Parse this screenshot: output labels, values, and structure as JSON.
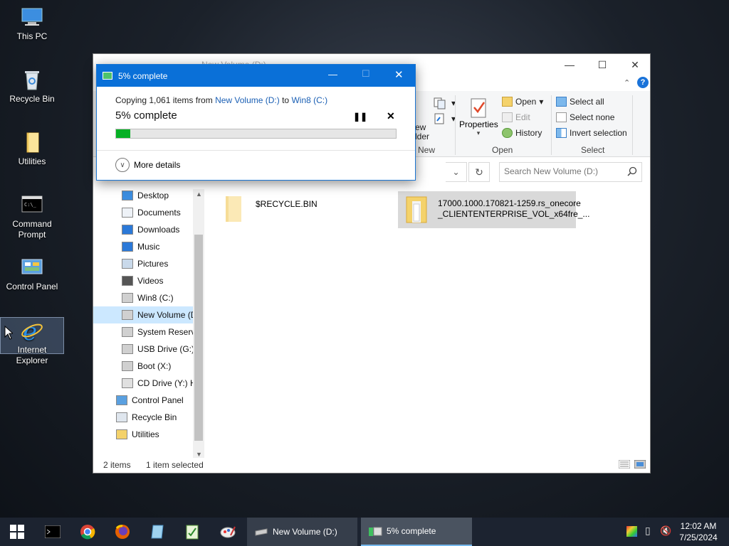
{
  "desktop": {
    "icons": [
      {
        "label": "This PC",
        "icon": "computer-icon"
      },
      {
        "label": "Recycle Bin",
        "icon": "recycle-bin-icon"
      },
      {
        "label": "Utilities",
        "icon": "folder-icon"
      },
      {
        "label": "Command Prompt",
        "icon": "cmd-icon"
      },
      {
        "label": "Control Panel",
        "icon": "control-panel-icon"
      },
      {
        "label": "Internet Explorer",
        "icon": "internet-explorer-icon"
      }
    ]
  },
  "explorer": {
    "title": "New Volume (D:)",
    "ribbon": {
      "new_partial": [
        "ew",
        "lder"
      ],
      "new_label": "New",
      "properties_label": "Properties",
      "open_label": "Open",
      "edit_label": "Edit",
      "history_label": "History",
      "open_group_label": "Open",
      "select_all_label": "Select all",
      "select_none_label": "Select none",
      "invert_selection_label": "Invert selection",
      "select_group_label": "Select"
    },
    "search_placeholder": "Search New Volume (D:)",
    "nav_items": [
      {
        "label": "Desktop",
        "icon": "desktop-icon"
      },
      {
        "label": "Documents",
        "icon": "documents-icon"
      },
      {
        "label": "Downloads",
        "icon": "downloads-icon"
      },
      {
        "label": "Music",
        "icon": "music-icon"
      },
      {
        "label": "Pictures",
        "icon": "pictures-icon"
      },
      {
        "label": "Videos",
        "icon": "videos-icon"
      },
      {
        "label": "Win8 (C:)",
        "icon": "drive-icon"
      },
      {
        "label": "New Volume (D:)",
        "icon": "drive-icon",
        "selected": true
      },
      {
        "label": "System Reserved",
        "icon": "drive-icon"
      },
      {
        "label": "USB Drive (G:)",
        "icon": "drive-icon"
      },
      {
        "label": "Boot (X:)",
        "icon": "drive-icon"
      },
      {
        "label": "CD Drive (Y:) H",
        "icon": "cd-drive-icon"
      },
      {
        "label": "Control Panel",
        "icon": "control-panel-icon"
      },
      {
        "label": "Recycle Bin",
        "icon": "recycle-bin-icon"
      },
      {
        "label": "Utilities",
        "icon": "folder-icon"
      }
    ],
    "files": [
      {
        "name": "$RECYCLE.BIN",
        "selected": false
      },
      {
        "name_line1": "17000.1000.170821-1259.rs_onecore",
        "name_line2": "_CLIENTENTERPRISE_VOL_x64fre_...",
        "selected": true
      }
    ],
    "status": {
      "items": "2 items",
      "selected": "1 item selected"
    }
  },
  "copy_dialog": {
    "title": "5% complete",
    "copying_prefix": "Copying 1,061 items from ",
    "source": "New Volume (D:)",
    "to_word": " to ",
    "destination": "Win8 (C:)",
    "percent_text": "5% complete",
    "progress_fraction": 0.05,
    "more_details": "More details"
  },
  "taskbar": {
    "pinned": [
      "start-icon",
      "cmd-icon",
      "chrome-icon",
      "firefox-icon",
      "notepad-icon",
      "checklist-icon",
      "paint-icon"
    ],
    "buttons": [
      {
        "label": "New Volume (D:)",
        "active": false
      },
      {
        "label": "5% complete",
        "active": true
      }
    ],
    "time": "12:02 AM",
    "date": "7/25/2024"
  },
  "colors": {
    "accent": "#0a70d8",
    "progress": "#06b025",
    "link": "#1a5fb4"
  }
}
